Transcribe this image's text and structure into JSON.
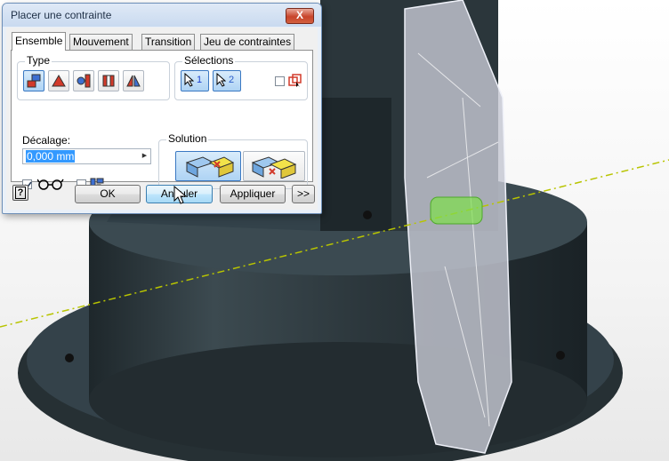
{
  "dialog": {
    "title": "Placer une contrainte",
    "close_label": "X",
    "tabs": [
      {
        "label": "Ensemble",
        "active": true
      },
      {
        "label": "Mouvement",
        "active": false
      },
      {
        "label": "Transition",
        "active": false
      },
      {
        "label": "Jeu de contraintes",
        "active": false
      }
    ],
    "type_group": {
      "title": "Type",
      "buttons": [
        "mate-constraint-icon",
        "angle-constraint-icon",
        "tangent-constraint-icon",
        "insert-constraint-icon",
        "symmetry-constraint-icon"
      ],
      "selected": "mate-constraint-icon"
    },
    "selections_group": {
      "title": "Sélections",
      "first_label": "1",
      "second_label": "2",
      "first_color": "#1a3fd0",
      "second_color": "#2a5cc9",
      "first_part_checked": false
    },
    "offset": {
      "label": "Décalage:",
      "value": "0,000 mm"
    },
    "preview_checked": true,
    "predict_offset_checked": false,
    "solution_group": {
      "title": "Solution",
      "options": [
        "mate-solution-icon",
        "flush-solution-icon"
      ],
      "selected": "mate-solution-icon"
    },
    "footer": {
      "ok_label": "OK",
      "cancel_label": "Annuler",
      "apply_label": "Appliquer",
      "expand_label": ">>"
    }
  },
  "colors": {
    "part_body": "#2f3b40",
    "axis_line": "#b8c400",
    "highlight": "#7ee04a",
    "dialog_background": "#f0f0f0"
  }
}
